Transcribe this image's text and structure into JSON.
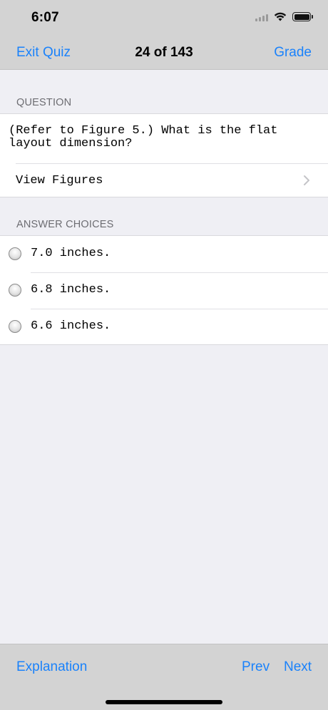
{
  "status_bar": {
    "time": "6:07"
  },
  "nav": {
    "left_label": "Exit Quiz",
    "title": "24 of 143",
    "right_label": "Grade"
  },
  "question_section": {
    "header": "QUESTION",
    "text": "(Refer to Figure 5.) What is the flat layout dimension?",
    "view_figures_label": "View Figures"
  },
  "answers_section": {
    "header": "ANSWER CHOICES",
    "choices": [
      {
        "label": "7.0 inches."
      },
      {
        "label": "6.8 inches."
      },
      {
        "label": "6.6 inches."
      }
    ]
  },
  "toolbar": {
    "explanation_label": "Explanation",
    "prev_label": "Prev",
    "next_label": "Next"
  },
  "colors": {
    "accent": "#1a82fb",
    "bar_background": "#d3d3d3",
    "page_background": "#efeff4"
  },
  "icons": [
    "wifi-icon",
    "battery-icon",
    "cellular-signal-icon",
    "chevron-right-icon",
    "radio-unselected-icon"
  ]
}
